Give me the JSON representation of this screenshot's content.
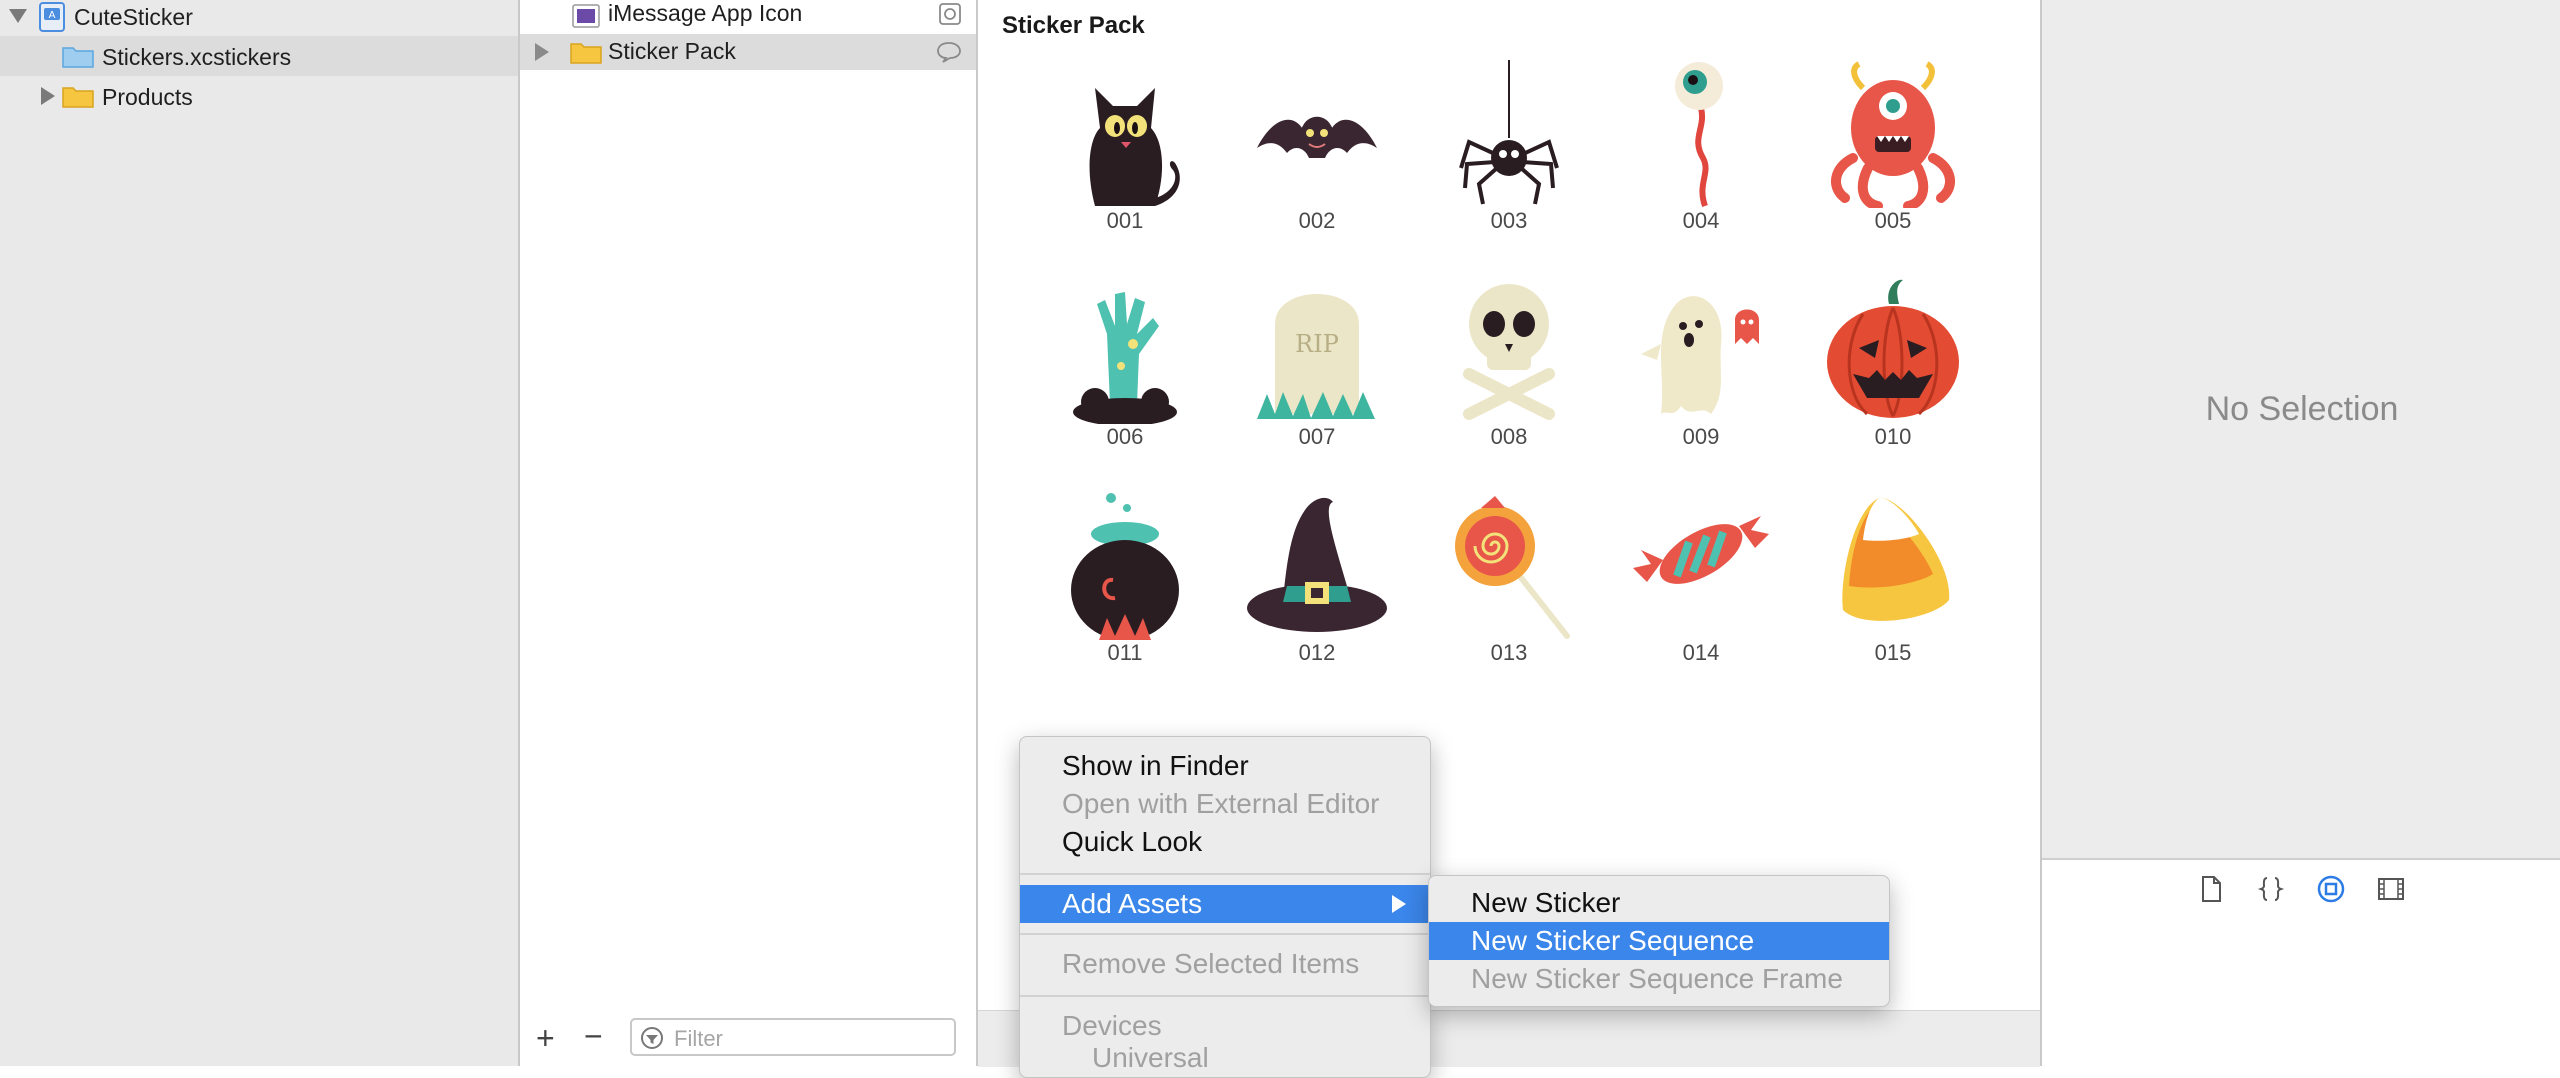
{
  "navigator": {
    "items": [
      {
        "label": "CuteSticker"
      },
      {
        "label": "Stickers.xcstickers"
      },
      {
        "label": "Products"
      }
    ]
  },
  "asset_list": {
    "items": [
      {
        "label": "iMessage App Icon"
      },
      {
        "label": "Sticker Pack"
      }
    ],
    "plus_label": "+",
    "minus_label": "−",
    "filter_placeholder": "Filter"
  },
  "editor": {
    "title": "Sticker Pack",
    "stickers": [
      {
        "label": "001",
        "icon": "cat-icon"
      },
      {
        "label": "002",
        "icon": "bat-icon"
      },
      {
        "label": "003",
        "icon": "spider-icon"
      },
      {
        "label": "004",
        "icon": "eyeball-icon"
      },
      {
        "label": "005",
        "icon": "monster-icon"
      },
      {
        "label": "006",
        "icon": "zombie-hand-icon"
      },
      {
        "label": "007",
        "icon": "tombstone-icon"
      },
      {
        "label": "008",
        "icon": "skull-icon"
      },
      {
        "label": "009",
        "icon": "ghost-icon"
      },
      {
        "label": "010",
        "icon": "pumpkin-icon"
      },
      {
        "label": "011",
        "icon": "cauldron-icon"
      },
      {
        "label": "012",
        "icon": "witch-hat-icon"
      },
      {
        "label": "013",
        "icon": "lollipop-icon"
      },
      {
        "label": "014",
        "icon": "candy-icon"
      },
      {
        "label": "015",
        "icon": "candy-corn-icon"
      }
    ],
    "tombstone_text": "RIP"
  },
  "inspector": {
    "no_selection": "No Selection"
  },
  "context_menu": {
    "items": [
      {
        "label": "Show in Finder",
        "enabled": true
      },
      {
        "label": "Open with External Editor",
        "enabled": false
      },
      {
        "label": "Quick Look",
        "enabled": true
      },
      {
        "label": "Add Assets",
        "enabled": true,
        "highlighted": true
      },
      {
        "label": "Remove Selected Items",
        "enabled": false
      },
      {
        "label": "Devices",
        "enabled": false
      },
      {
        "label": "Universal",
        "enabled": false
      }
    ]
  },
  "submenu": {
    "items": [
      {
        "label": "New Sticker",
        "enabled": true
      },
      {
        "label": "New Sticker Sequence",
        "enabled": true,
        "highlighted": true
      },
      {
        "label": "New Sticker Sequence Frame",
        "enabled": false
      }
    ]
  },
  "colors": {
    "highlight": "#3b86ea",
    "folder": "#f7c640",
    "selection_gray": "#dcdcdc"
  }
}
